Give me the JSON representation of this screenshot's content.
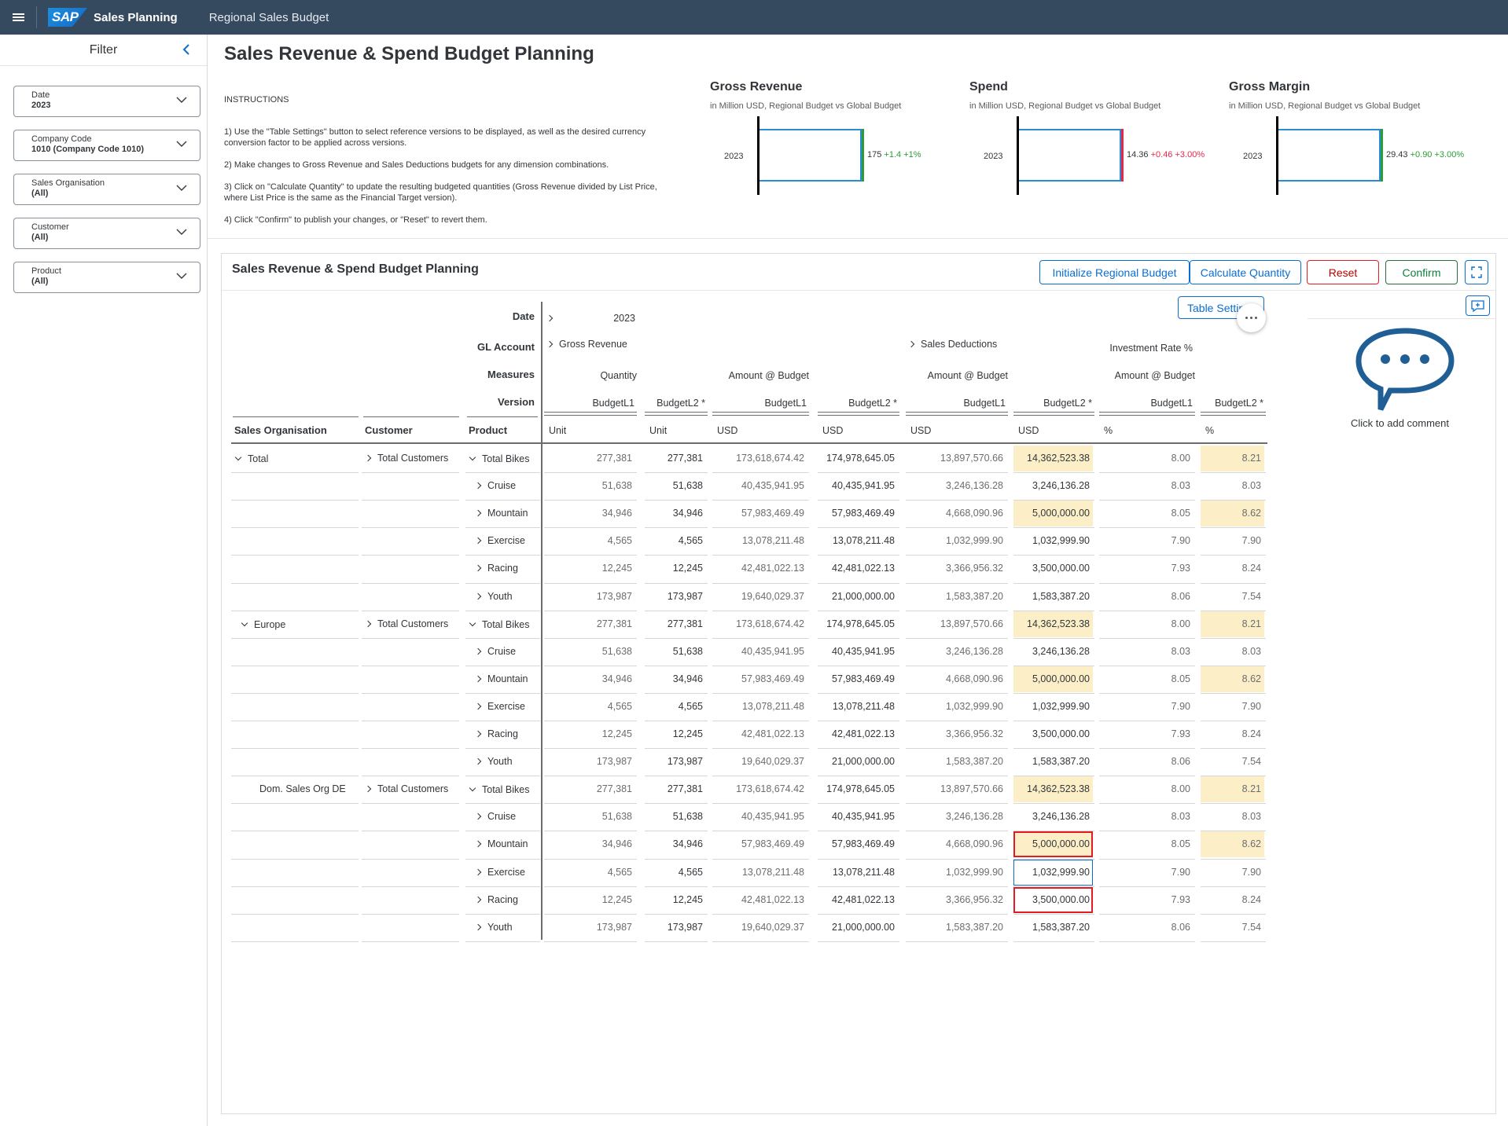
{
  "shell": {
    "title": "Sales Planning",
    "subtitle": "Regional Sales Budget",
    "logo": "SAP"
  },
  "filter": {
    "title": "Filter",
    "fields": [
      {
        "label": "Date",
        "value": "2023"
      },
      {
        "label": "Company Code",
        "value": "1010 (Company Code 1010)"
      },
      {
        "label": "Sales Organisation",
        "value": "(All)"
      },
      {
        "label": "Customer",
        "value": "(All)"
      },
      {
        "label": "Product",
        "value": "(All)"
      }
    ]
  },
  "page": {
    "title": "Sales Revenue & Spend Budget Planning",
    "instructions_title": "INSTRUCTIONS",
    "instructions": [
      "1) Use the \"Table Settings\" button to select reference versions to be displayed, as well as the desired currency conversion factor to be applied across versions.",
      "2) Make changes to Gross Revenue and Sales Deductions budgets for any dimension combinations.",
      "3) Click on \"Calculate Quantity\" to update the resulting budgeted quantities (Gross Revenue divided by List Price, where List Price is the same as the Financial Target version).",
      "4) Click \"Confirm\" to publish your changes, or \"Reset\" to revert them."
    ]
  },
  "kpis": [
    {
      "title": "Gross Revenue",
      "subtitle": "in Million USD, Regional Budget vs Global Budget",
      "year": "2023",
      "value": "175",
      "delta": "+1.4 +1%",
      "trend": "up",
      "color": "#2b9c37"
    },
    {
      "title": "Spend",
      "subtitle": "in Million USD, Regional Budget vs Global Budget",
      "year": "2023",
      "value": "14.36",
      "delta": "+0.46 +3.00%",
      "trend": "down",
      "color": "#e8264b"
    },
    {
      "title": "Gross Margin",
      "subtitle": "in Million USD, Regional Budget vs Global Budget",
      "year": "2023",
      "value": "29.43",
      "delta": "+0.90 +3.00%",
      "trend": "up",
      "color": "#2b9c37"
    }
  ],
  "card": {
    "title": "Sales Revenue & Spend Budget Planning",
    "buttons": {
      "init": "Initialize Regional Budget",
      "calc": "Calculate Quantity",
      "reset": "Reset",
      "confirm": "Confirm"
    },
    "table_settings": "Table Settings",
    "comment_text": "Click to add comment"
  },
  "grid": {
    "dim_labels": {
      "date": "Date",
      "gl": "GL Account",
      "measures": "Measures",
      "version": "Version"
    },
    "date_value": "2023",
    "gl_values": [
      "Gross Revenue",
      "Sales Deductions",
      "Investment Rate %"
    ],
    "measures": [
      "Quantity",
      "Amount @ Budget",
      "Amount @ Budget",
      "Amount @ Budget"
    ],
    "versions": [
      "BudgetL1",
      "BudgetL2 *",
      "BudgetL1",
      "BudgetL2 *",
      "BudgetL1",
      "BudgetL2 *",
      "BudgetL1",
      "BudgetL2 *"
    ],
    "row_headers": [
      "Sales Organisation",
      "Customer",
      "Product"
    ],
    "units": [
      "Unit",
      "Unit",
      "USD",
      "USD",
      "USD",
      "USD",
      "%",
      "%"
    ],
    "groups": [
      {
        "org": "Total",
        "customer": "Total Customers"
      },
      {
        "org": "Europe",
        "customer": "Total Customers"
      },
      {
        "org": "Dom. Sales Org DE",
        "customer": "Total Customers"
      }
    ],
    "products": [
      "Total Bikes",
      "Cruise",
      "Mountain",
      "Exercise",
      "Racing",
      "Youth"
    ],
    "rows": [
      [
        "277,381",
        "277,381",
        "173,618,674.42",
        "174,978,645.05",
        "13,897,570.66",
        "14,362,523.38",
        "8.00",
        "8.21"
      ],
      [
        "51,638",
        "51,638",
        "40,435,941.95",
        "40,435,941.95",
        "3,246,136.28",
        "3,246,136.28",
        "8.03",
        "8.03"
      ],
      [
        "34,946",
        "34,946",
        "57,983,469.49",
        "57,983,469.49",
        "4,668,090.96",
        "5,000,000.00",
        "8.05",
        "8.62"
      ],
      [
        "4,565",
        "4,565",
        "13,078,211.48",
        "13,078,211.48",
        "1,032,999.90",
        "1,032,999.90",
        "7.90",
        "7.90"
      ],
      [
        "12,245",
        "12,245",
        "42,481,022.13",
        "42,481,022.13",
        "3,366,956.32",
        "3,500,000.00",
        "7.93",
        "8.24"
      ],
      [
        "173,987",
        "173,987",
        "19,640,029.37",
        "21,000,000.00",
        "1,583,387.20",
        "1,583,387.20",
        "8.06",
        "7.54"
      ]
    ]
  }
}
